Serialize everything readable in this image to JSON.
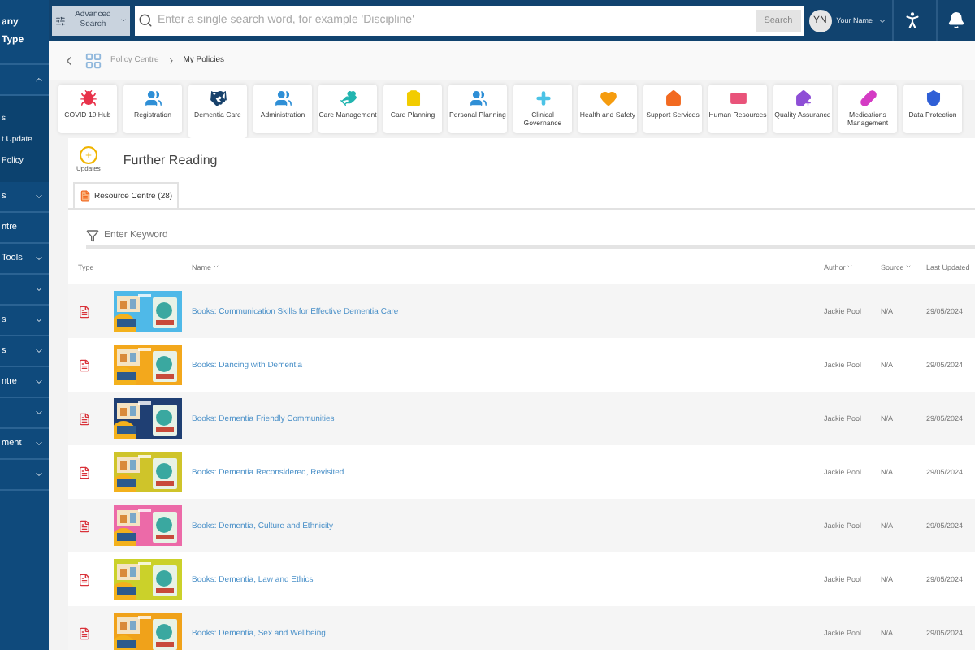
{
  "sidebar": {
    "header": [
      "any",
      "Type"
    ],
    "items": [
      {
        "kind": "group",
        "expanded": true,
        "children": [
          {
            "label": "s"
          },
          {
            "label": "t Update"
          },
          {
            "label": "Policy"
          }
        ]
      },
      {
        "kind": "group",
        "label": "s",
        "expanded": false
      },
      {
        "kind": "link",
        "label": "ntre"
      },
      {
        "kind": "group",
        "label": "Tools",
        "expanded": false
      },
      {
        "kind": "group",
        "expanded": false
      },
      {
        "kind": "group",
        "label": "s",
        "expanded": false
      },
      {
        "kind": "group",
        "label": "s",
        "expanded": false
      },
      {
        "kind": "group",
        "label": "ntre",
        "expanded": false
      },
      {
        "kind": "group",
        "expanded": false
      },
      {
        "kind": "group",
        "label": "ment",
        "expanded": false
      },
      {
        "kind": "group",
        "expanded": false
      }
    ]
  },
  "topbar": {
    "advanced_search": "Advanced Search",
    "search": {
      "placeholder": "Enter a single search word, for example 'Discipline'"
    },
    "search_button": "Search",
    "avatar": "YN",
    "user": "Your Name"
  },
  "breadcrumb": [
    "Policy Centre",
    "My Policies"
  ],
  "categories": [
    {
      "label": "COVID 19 Hub",
      "kind": "virus",
      "color": "#e8324a",
      "selected": false
    },
    {
      "label": "Registration",
      "kind": "people",
      "color": "#2f8fd6",
      "selected": false
    },
    {
      "label": "Dementia Care",
      "kind": "handshake",
      "color": "#17416b",
      "selected": true
    },
    {
      "label": "Administration",
      "kind": "people",
      "color": "#2f8fd6",
      "selected": false
    },
    {
      "label": "Care Management",
      "kind": "hands",
      "color": "#22b5b0",
      "selected": false
    },
    {
      "label": "Care Planning",
      "kind": "clipboard",
      "color": "#f2cc00",
      "selected": false
    },
    {
      "label": "Personal Planning",
      "kind": "people",
      "color": "#2f8fd6",
      "selected": false
    },
    {
      "label": "Clinical Governance",
      "kind": "cross",
      "color": "#4cc3e6",
      "selected": false
    },
    {
      "label": "Health and Safety",
      "kind": "heart",
      "color": "#f59c0f",
      "selected": false
    },
    {
      "label": "Support Services",
      "kind": "house",
      "color": "#f26a21",
      "selected": false
    },
    {
      "label": "Human Resources",
      "kind": "badge",
      "color": "#e9537a",
      "selected": false
    },
    {
      "label": "Quality Assurance",
      "kind": "housecheck",
      "color": "#8e4fd6",
      "selected": false
    },
    {
      "label": "Medications Management",
      "kind": "pill",
      "color": "#d43bc4",
      "selected": false
    },
    {
      "label": "Data Protection",
      "kind": "shield",
      "color": "#2f5fd6",
      "selected": false
    }
  ],
  "section": {
    "updates": "Updates",
    "title": "Further Reading",
    "tab": "Resource Centre (28)",
    "filter": {
      "placeholder": "Enter Keyword"
    }
  },
  "table": {
    "columns": [
      {
        "label": "Type"
      },
      {
        "label": "Name",
        "sortable": true
      },
      {
        "label": "Author",
        "sortable": true
      },
      {
        "label": "Source",
        "sortable": true
      },
      {
        "label": "Last Updated"
      }
    ],
    "rows": [
      {
        "name": "Books: Communication Skills for Effective Dementia Care",
        "author": "Jackie Pool",
        "source": "N/A",
        "updated": "29/05/2024",
        "color": "#4fb9e8"
      },
      {
        "name": "Books: Dancing with Dementia",
        "author": "Jackie Pool",
        "source": "N/A",
        "updated": "29/05/2024",
        "color": "#f3a81c"
      },
      {
        "name": "Books: Dementia Friendly Communities",
        "author": "Jackie Pool",
        "source": "N/A",
        "updated": "29/05/2024",
        "color": "#1f3f73"
      },
      {
        "name": "Books: Dementia Reconsidered, Revisited",
        "author": "Jackie Pool",
        "source": "N/A",
        "updated": "29/05/2024",
        "color": "#cfc42a"
      },
      {
        "name": "Books: Dementia, Culture and Ethnicity",
        "author": "Jackie Pool",
        "source": "N/A",
        "updated": "29/05/2024",
        "color": "#ec6aa8"
      },
      {
        "name": "Books: Dementia, Law and Ethics",
        "author": "Jackie Pool",
        "source": "N/A",
        "updated": "29/05/2024",
        "color": "#cbd12a"
      },
      {
        "name": "Books: Dementia, Sex and Wellbeing",
        "author": "Jackie Pool",
        "source": "N/A",
        "updated": "29/05/2024",
        "color": "#f0a21a"
      }
    ]
  }
}
